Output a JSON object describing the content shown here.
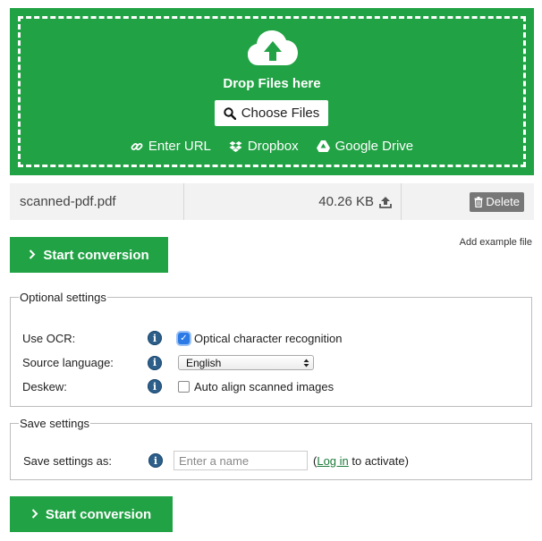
{
  "upload": {
    "drop_text": "Drop Files here",
    "choose_label": "Choose Files",
    "sources": [
      {
        "label": "Enter URL",
        "icon": "link-icon"
      },
      {
        "label": "Dropbox",
        "icon": "dropbox-icon"
      },
      {
        "label": "Google Drive",
        "icon": "google-drive-icon"
      }
    ],
    "color": "#21a244"
  },
  "file": {
    "name": "scanned-pdf.pdf",
    "size": "40.26 KB",
    "delete_label": "Delete"
  },
  "actions": {
    "start_label": "Start conversion",
    "add_example": "Add example file"
  },
  "optional_settings": {
    "legend": "Optional settings",
    "ocr_label": "Use OCR:",
    "ocr_option": "Optical character recognition",
    "ocr_checked": true,
    "language_label": "Source language:",
    "language_value": "English",
    "deskew_label": "Deskew:",
    "deskew_option": "Auto align scanned images",
    "deskew_checked": false
  },
  "save_settings": {
    "legend": "Save settings",
    "label": "Save settings as:",
    "placeholder": "Enter a name",
    "note_prefix": "(",
    "login_link": "Log in",
    "note_suffix": " to activate)"
  }
}
